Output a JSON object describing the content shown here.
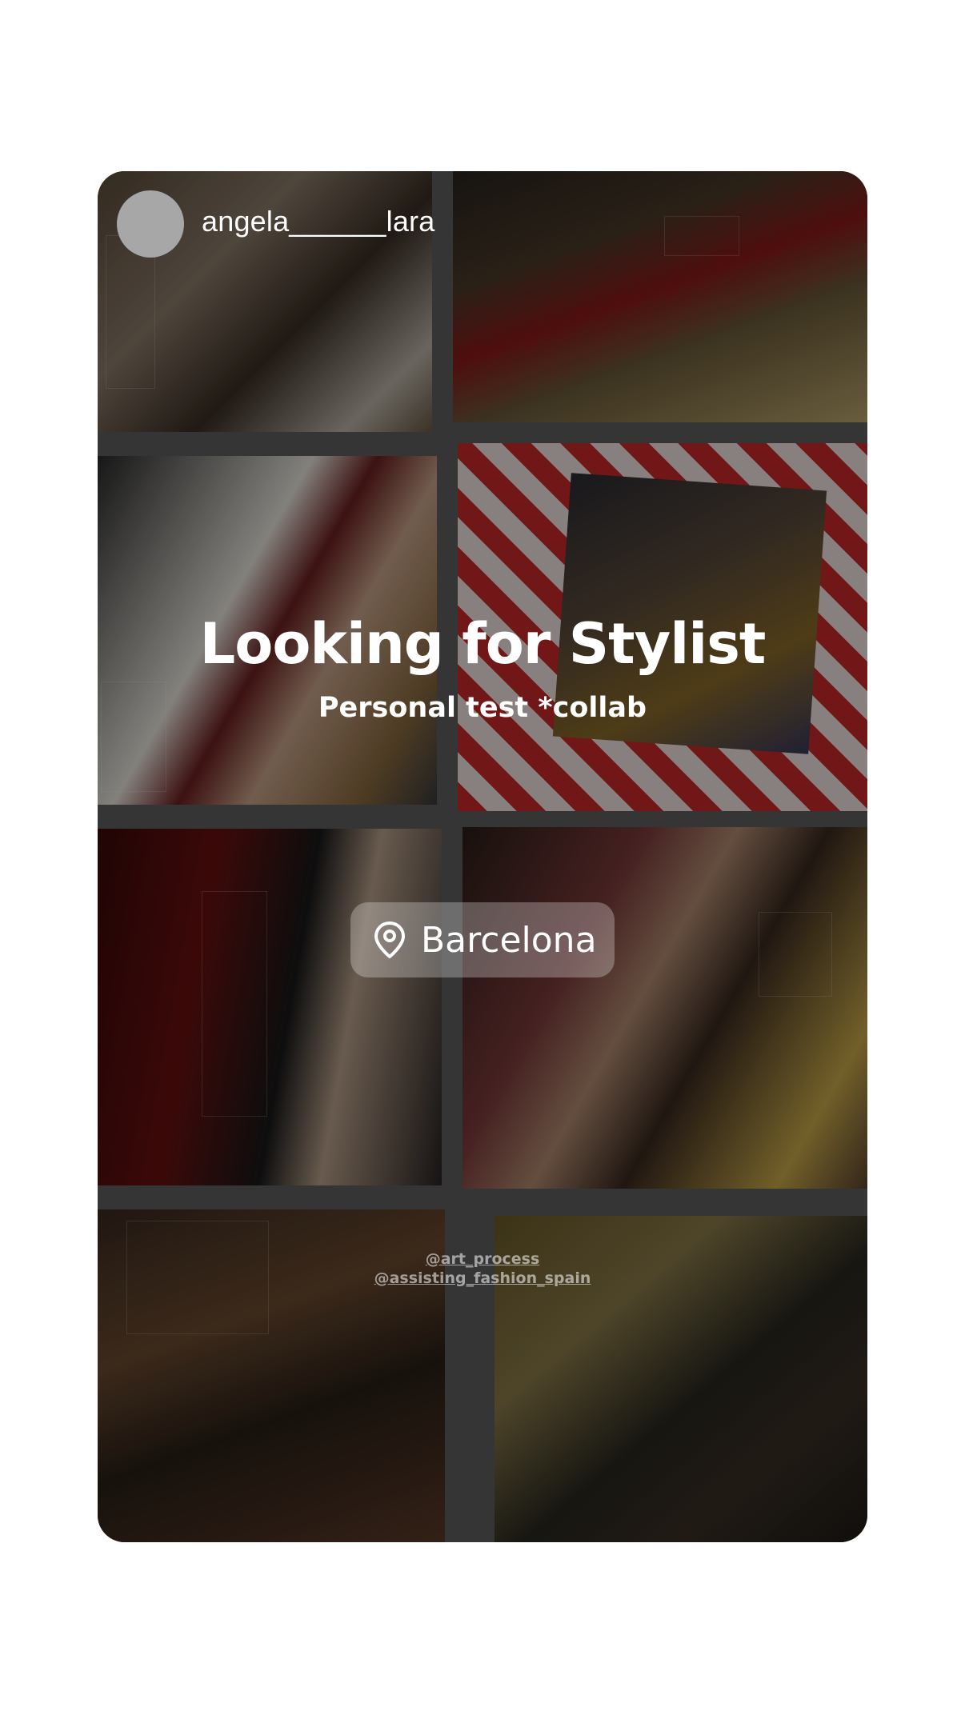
{
  "story": {
    "username": "angela______lara",
    "title": "Looking for Stylist",
    "subtitle": "Personal test *collab",
    "location": {
      "icon": "location-pin-icon",
      "label": "Barcelona"
    },
    "mentions": [
      "@art_process",
      "@assisting_fashion_spain"
    ]
  },
  "colors": {
    "page_background": "#ffffff",
    "avatar_placeholder": "#a7a7a7",
    "text": "#ffffff"
  }
}
